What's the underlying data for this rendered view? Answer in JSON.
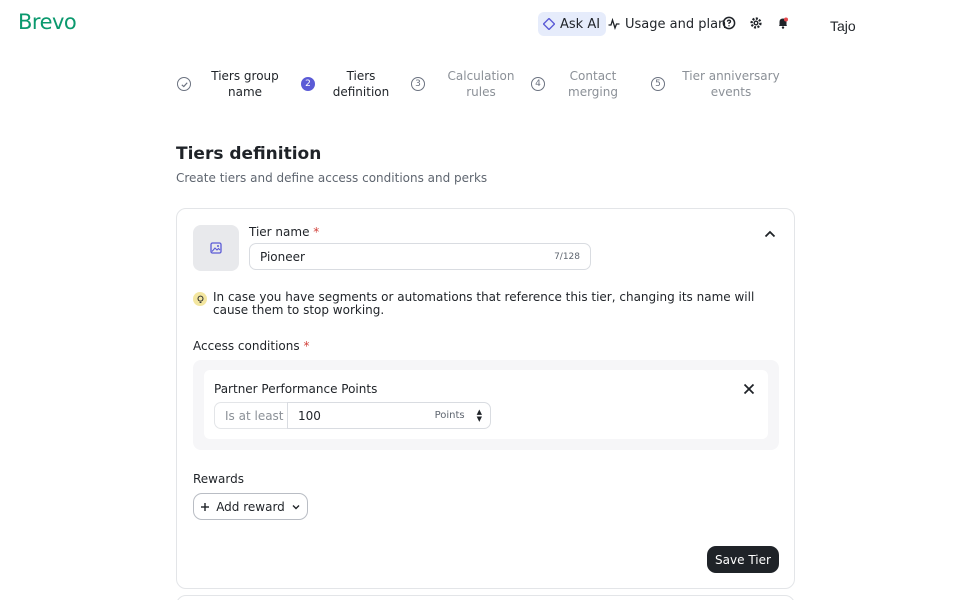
{
  "header": {
    "logo": "Brevo",
    "ask_ai": "Ask AI",
    "usage": "Usage and plan",
    "user": "Tajo",
    "icons": [
      "help-icon",
      "gear-icon",
      "bell-icon"
    ]
  },
  "steps": [
    {
      "number": "",
      "label": "Tiers group name",
      "state": "done"
    },
    {
      "number": "2",
      "label": "Tiers definition",
      "state": "active"
    },
    {
      "number": "3",
      "label": "Calculation rules",
      "state": "upcoming"
    },
    {
      "number": "4",
      "label": "Contact merging",
      "state": "upcoming"
    },
    {
      "number": "5",
      "label": "Tier anniversary events",
      "state": "upcoming"
    }
  ],
  "page": {
    "title": "Tiers definition",
    "subtitle": "Create tiers and define access conditions and perks"
  },
  "tier": {
    "name_label": "Tier name",
    "required_mark": "*",
    "name_value": "Pioneer",
    "name_count": "7/128",
    "warning": "In case you have segments or automations that reference this tier, changing its name will cause them to stop working.",
    "access_label": "Access conditions",
    "condition": {
      "title": "Partner Performance Points",
      "operator": "Is at least",
      "value": "100",
      "unit": "Points"
    },
    "rewards_label": "Rewards",
    "add_reward": "Add reward",
    "save": "Save Tier"
  },
  "colors": {
    "brand": "#0b996e",
    "accent": "#5b5bd6",
    "primary_button": "#1f2328"
  }
}
